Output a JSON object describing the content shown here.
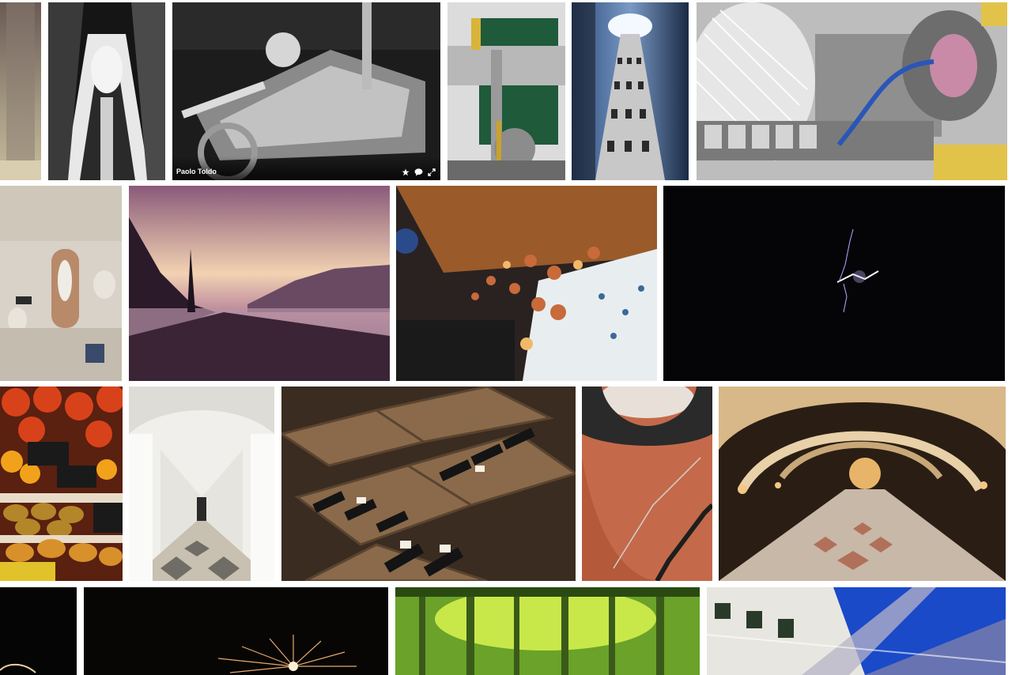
{
  "gallery": {
    "hover_tile": {
      "owner": "Paolo Toldo",
      "actions": [
        "favorite-icon",
        "comment-icon",
        "expand-icon"
      ]
    },
    "tiles": [
      {
        "subject": "doorway-photo"
      },
      {
        "subject": "stairwell-photo"
      },
      {
        "subject": "steam-engine-photo"
      },
      {
        "subject": "machinery-photo"
      },
      {
        "subject": "elevator-tower-photo"
      },
      {
        "subject": "jet-engine-photo"
      },
      {
        "subject": "baroque-hall-photo"
      },
      {
        "subject": "lake-sunset-photo"
      },
      {
        "subject": "lantern-shop-photo"
      },
      {
        "subject": "lightning-photo"
      },
      {
        "subject": "fruit-market-photo"
      },
      {
        "subject": "white-corridor-photo"
      },
      {
        "subject": "wine-crates-photo"
      },
      {
        "subject": "brick-staircase-photo"
      },
      {
        "subject": "antiquarium-photo"
      },
      {
        "subject": "night-photo"
      },
      {
        "subject": "fireworks-photo"
      },
      {
        "subject": "bamboo-forest-photo"
      },
      {
        "subject": "glass-roof-photo"
      }
    ]
  }
}
